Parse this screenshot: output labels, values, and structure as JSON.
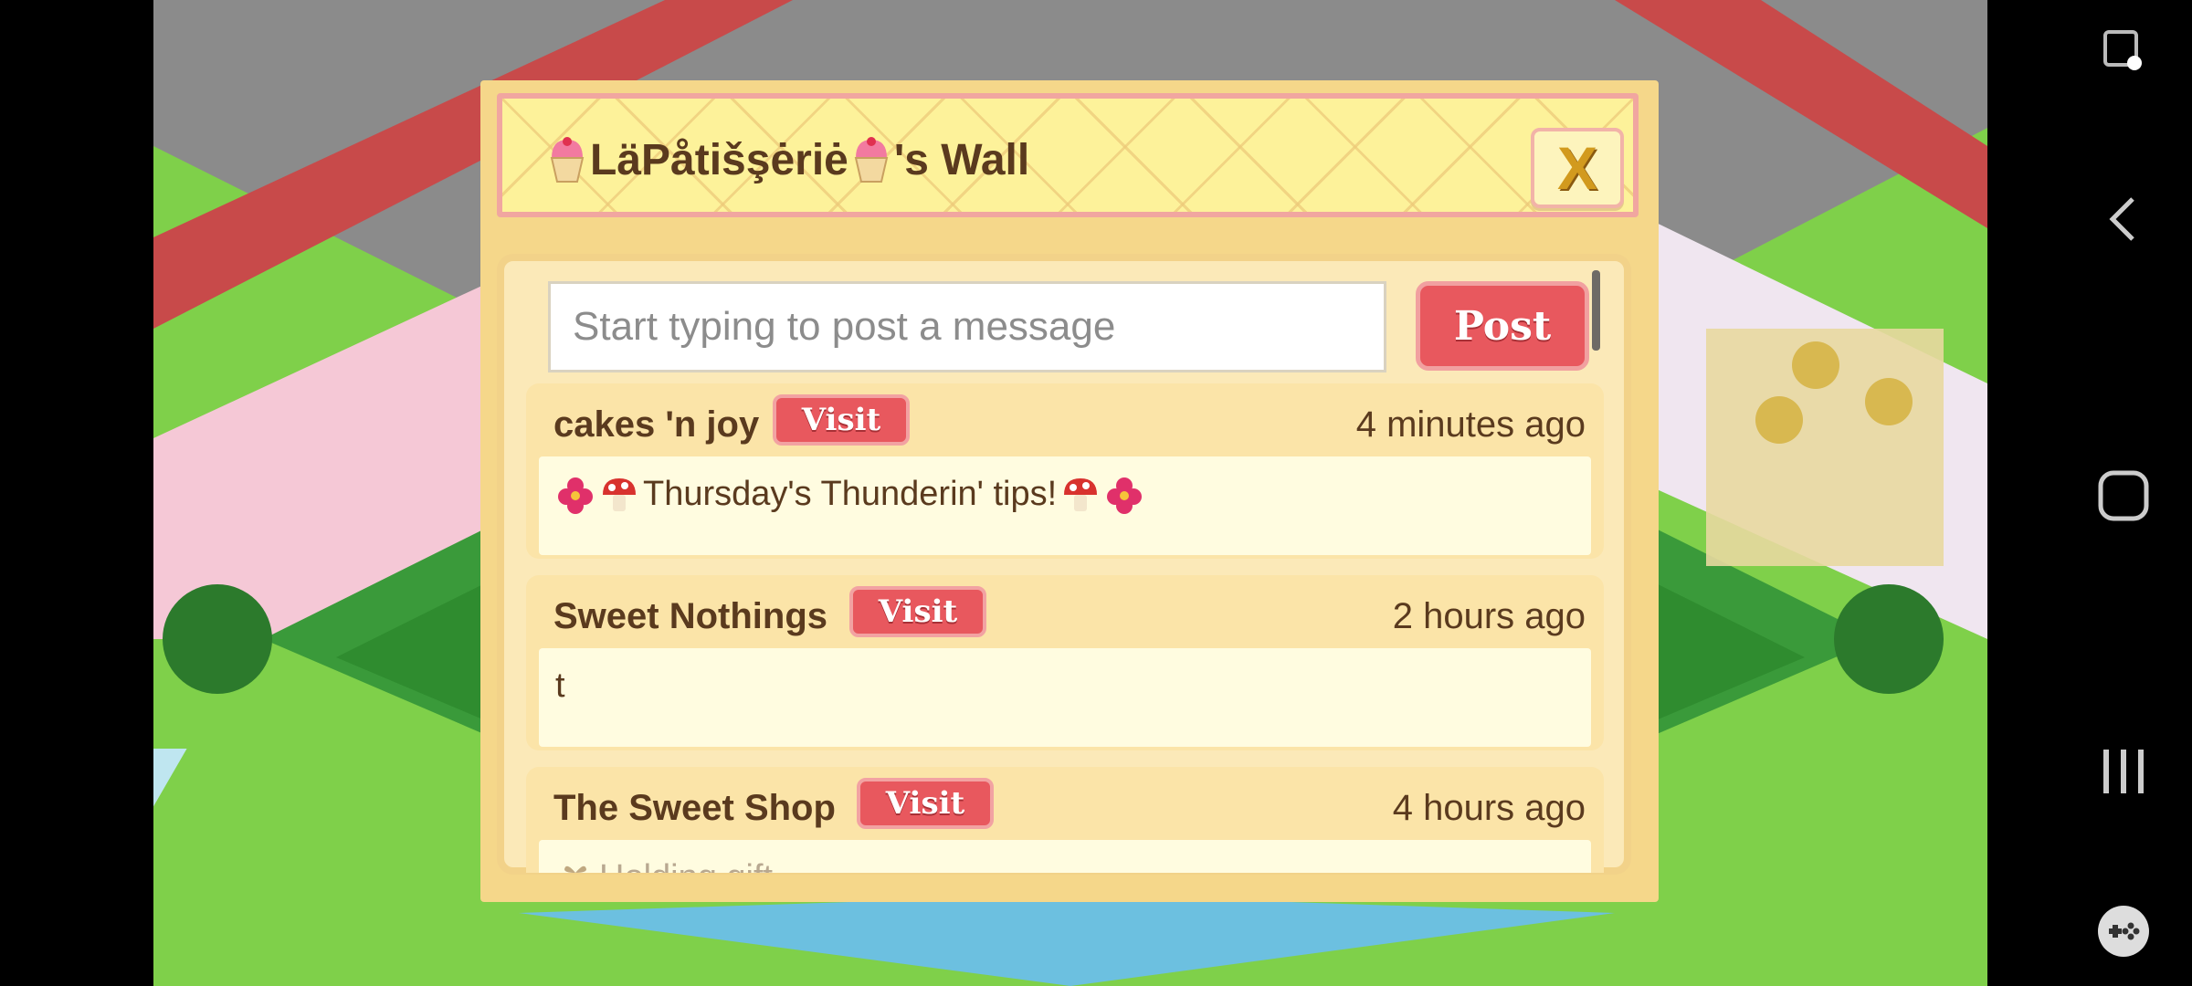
{
  "wall": {
    "title_name": "LäPåtišşėriė",
    "title_suffix": "'s Wall",
    "close_label": "X",
    "input_placeholder": "Start typing to post a message",
    "post_label": "Post"
  },
  "posts": [
    {
      "author": "cakes 'n joy",
      "visit_label": "Visit",
      "time": "4 minutes ago",
      "message": "Thursday's Thunderin' tips!"
    },
    {
      "author": "Sweet Nothings",
      "visit_label": "Visit",
      "time": "2 hours ago",
      "message": "t"
    },
    {
      "author": "The Sweet Shop",
      "visit_label": "Visit",
      "time": "4 hours ago",
      "message": "Holding gift"
    }
  ],
  "icons": {
    "close": "close-icon",
    "cupcake": "cupcake-icon",
    "flower": "flower-icon",
    "mushroom": "mushroom-icon",
    "gift": "gift-icon",
    "screen_capture": "screen-capture-icon",
    "back": "back-icon",
    "home": "home-icon",
    "recents": "recents-icon",
    "game_tools": "game-tools-icon"
  },
  "colors": {
    "accent_red": "#e8585e",
    "header_yellow": "#fdf29a",
    "panel_tan": "#f5d78a",
    "text_brown": "#5a3a1e"
  }
}
